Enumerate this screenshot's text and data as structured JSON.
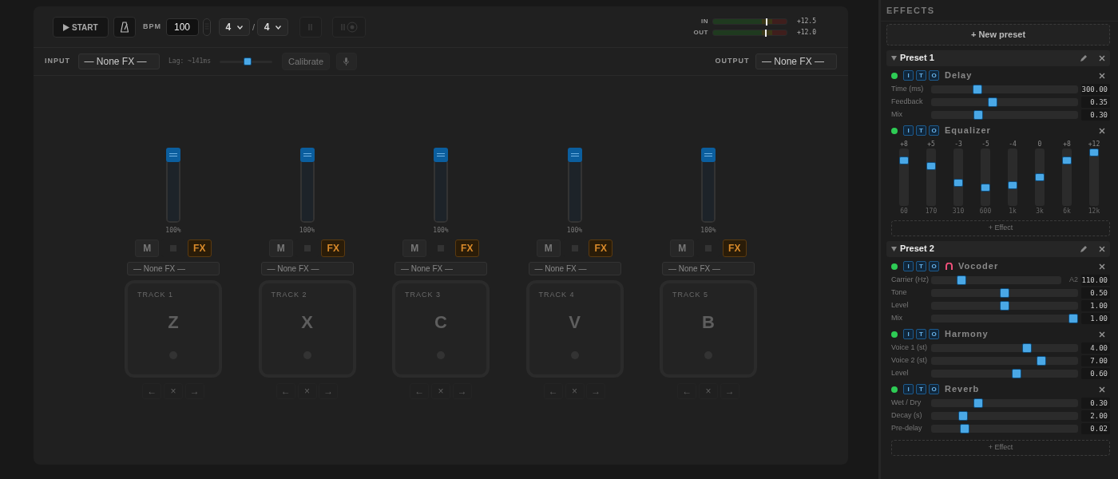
{
  "transport": {
    "start": "START",
    "bpm_label": "BPM",
    "bpm": "100",
    "beats": "4",
    "separator": "/",
    "note_value": "4"
  },
  "meters": [
    {
      "label": "IN",
      "level": 0.71,
      "reading": "+12.5"
    },
    {
      "label": "OUT",
      "level": 0.7,
      "reading": "+12.0"
    }
  ],
  "input": {
    "label": "INPUT",
    "fx": "— None FX —",
    "lag": "Lag: ~141ms",
    "lag_slider": {
      "level": 0.54
    },
    "calibrate": "Calibrate"
  },
  "output": {
    "label": "OUTPUT",
    "fx": "— None FX —"
  },
  "tracks": [
    {
      "label": "TRACK 1",
      "key": "Z",
      "level": 1,
      "reading": "100%",
      "mute": "M",
      "muted": false,
      "fx": "FX",
      "fx_on": true,
      "fx_select": "— None FX —",
      "pad_buttons": [
        "←",
        "×",
        "→"
      ]
    },
    {
      "label": "TRACK 2",
      "key": "X",
      "level": 1,
      "reading": "100%",
      "mute": "M",
      "muted": false,
      "fx": "FX",
      "fx_on": true,
      "fx_select": "— None FX —",
      "pad_buttons": [
        "←",
        "×",
        "→"
      ]
    },
    {
      "label": "TRACK 3",
      "key": "C",
      "level": 1,
      "reading": "100%",
      "mute": "M",
      "muted": false,
      "fx": "FX",
      "fx_on": true,
      "fx_select": "— None FX —",
      "pad_buttons": [
        "←",
        "×",
        "→"
      ]
    },
    {
      "label": "TRACK 4",
      "key": "V",
      "level": 1,
      "reading": "100%",
      "mute": "M",
      "muted": false,
      "fx": "FX",
      "fx_on": true,
      "fx_select": "— None FX —",
      "pad_buttons": [
        "←",
        "×",
        "→"
      ]
    },
    {
      "label": "TRACK 5",
      "key": "B",
      "level": 1,
      "reading": "100%",
      "mute": "M",
      "muted": false,
      "fx": "FX",
      "fx_on": true,
      "fx_select": "— None FX —",
      "pad_buttons": [
        "←",
        "×",
        "→"
      ]
    }
  ],
  "effects": {
    "title": "EFFECTS",
    "new_preset": "+ New preset",
    "presets": [
      {
        "name": "Preset 1",
        "expanded": true,
        "add_effect": "+ Effect",
        "effects": [
          {
            "kind": "sliders",
            "name": "Delay",
            "enabled": true,
            "routing": [
              "I",
              "T",
              "O"
            ],
            "params": [
              {
                "label": "Time (ms)",
                "level": 0.3,
                "value": "300.00"
              },
              {
                "label": "Feedback",
                "level": 0.41,
                "value": "0.35"
              },
              {
                "label": "Mix",
                "level": 0.31,
                "value": "0.30"
              }
            ]
          },
          {
            "kind": "eq",
            "name": "Equalizer",
            "enabled": true,
            "routing": [
              "I",
              "T",
              "O"
            ],
            "bands": [
              {
                "gain": "+8",
                "level": 0.83,
                "freq": "60"
              },
              {
                "gain": "+5",
                "level": 0.71,
                "freq": "170"
              },
              {
                "gain": "-3",
                "level": 0.38,
                "freq": "310"
              },
              {
                "gain": "-5",
                "level": 0.29,
                "freq": "600"
              },
              {
                "gain": "-4",
                "level": 0.33,
                "freq": "1k"
              },
              {
                "gain": "0",
                "level": 0.5,
                "freq": "3k"
              },
              {
                "gain": "+8",
                "level": 0.83,
                "freq": "6k"
              },
              {
                "gain": "+12",
                "level": 1,
                "freq": "12k"
              }
            ]
          }
        ]
      },
      {
        "name": "Preset 2",
        "expanded": true,
        "add_effect": "+ Effect",
        "effects": [
          {
            "kind": "sliders",
            "name": "Vocoder",
            "enabled": true,
            "icon_shown": true,
            "routing": [
              "I",
              "T",
              "O"
            ],
            "params": [
              {
                "label": "Carrier (Hz)",
                "level": 0.21,
                "note": "A2",
                "value": "110.00"
              },
              {
                "label": "Tone",
                "level": 0.5,
                "value": "0.50"
              },
              {
                "label": "Level",
                "level": 0.5,
                "value": "1.00"
              },
              {
                "label": "Mix",
                "level": 1,
                "value": "1.00"
              }
            ]
          },
          {
            "kind": "sliders",
            "name": "Harmony",
            "enabled": true,
            "routing": [
              "I",
              "T",
              "O"
            ],
            "params": [
              {
                "label": "Voice 1 (st)",
                "level": 0.66,
                "value": "4.00"
              },
              {
                "label": "Voice 2 (st)",
                "level": 0.77,
                "value": "7.00"
              },
              {
                "label": "Level",
                "level": 0.59,
                "value": "0.60"
              }
            ]
          },
          {
            "kind": "sliders",
            "name": "Reverb",
            "enabled": true,
            "routing": [
              "I",
              "T",
              "O"
            ],
            "params": [
              {
                "label": "Wet / Dry",
                "level": 0.31,
                "value": "0.30"
              },
              {
                "label": "Decay (s)",
                "level": 0.2,
                "value": "2.00"
              },
              {
                "label": "Pre-delay",
                "level": 0.21,
                "value": "0.02"
              }
            ]
          }
        ]
      }
    ]
  }
}
